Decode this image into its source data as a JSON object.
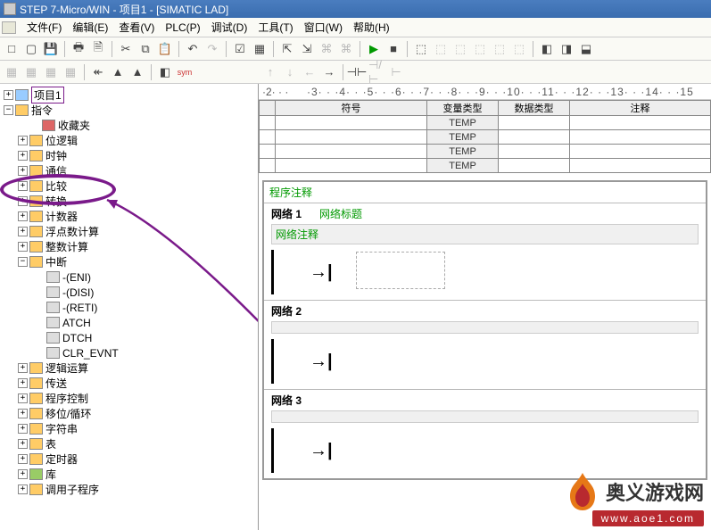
{
  "title": "STEP 7-Micro/WIN - 项目1 - [SIMATIC LAD]",
  "menu": {
    "file": "文件(F)",
    "edit": "编辑(E)",
    "view": "查看(V)",
    "plc": "PLC(P)",
    "debug": "调试(D)",
    "tools": "工具(T)",
    "window": "窗口(W)",
    "help": "帮助(H)"
  },
  "toolbar": {
    "new": "□",
    "open": "▢",
    "save": "💾",
    "print": "🖶",
    "preview": "🗎",
    "cut": "✂",
    "copy": "⧉",
    "paste": "📋",
    "undo": "↶",
    "redo": "↷",
    "check": "☑",
    "a1": "▦",
    "a2": "▦",
    "d1": "⇱",
    "d2": "⇲",
    "d3": "⌘",
    "d4": "⌘",
    "run": "▶",
    "stop": "■",
    "m1": "⬚",
    "m2": "⬚",
    "m3": "⬚",
    "m4": "⬚",
    "m5": "⬚",
    "m6": "⬚",
    "b1": "◧",
    "b2": "◨",
    "b3": "⬓"
  },
  "lefttb": {
    "t1": "▦",
    "t2": "▦",
    "t3": "▦",
    "t4": "▦",
    "t5": "↞",
    "t6": "▲",
    "t7": "▲",
    "t8": "◧",
    "t9": "sym"
  },
  "righttb": {
    "r1": "↑",
    "r2": "↓",
    "r3": "←",
    "r4": "→",
    "r5": "⊣⊢",
    "r6": "⊣/⊢",
    "r7": "⊢"
  },
  "tree": {
    "root": "项目1",
    "n0": "指令",
    "n1": "收藏夹",
    "n2": "位逻辑",
    "n3": "时钟",
    "n4": "通信",
    "n5": "比较",
    "n6": "转换",
    "n7": "计数器",
    "n8": "浮点数计算",
    "n9": "整数计算",
    "n10": "中断",
    "s1": "-(ENI)",
    "s2": "-(DISI)",
    "s3": "-(RETI)",
    "s4": "ATCH",
    "s5": "DTCH",
    "s6": "CLR_EVNT",
    "n11": "逻辑运算",
    "n12": "传送",
    "n13": "程序控制",
    "n14": "移位/循环",
    "n15": "字符串",
    "n16": "表",
    "n17": "定时器",
    "n18": "库",
    "n19": "调用子程序"
  },
  "ruler": {
    "r1": "·2· · ·",
    "r2": "·3· · ·4· · ·5· · ·6· · ·7· · ·8· · ·9· · ·10· · ·11· · ·12· · ·13· · ·14· · ·15"
  },
  "vartable": {
    "h1": "符号",
    "h2": "变量类型",
    "h3": "数据类型",
    "h4": "注释",
    "temp": "TEMP"
  },
  "ladder": {
    "prog": "程序注释",
    "net1": "网络 1",
    "net1t": "网络标题",
    "net1c": "网络注释",
    "net2": "网络 2",
    "net3": "网络 3"
  },
  "watermark": {
    "text": "奥义游戏网",
    "url": "www.aoe1.com"
  }
}
